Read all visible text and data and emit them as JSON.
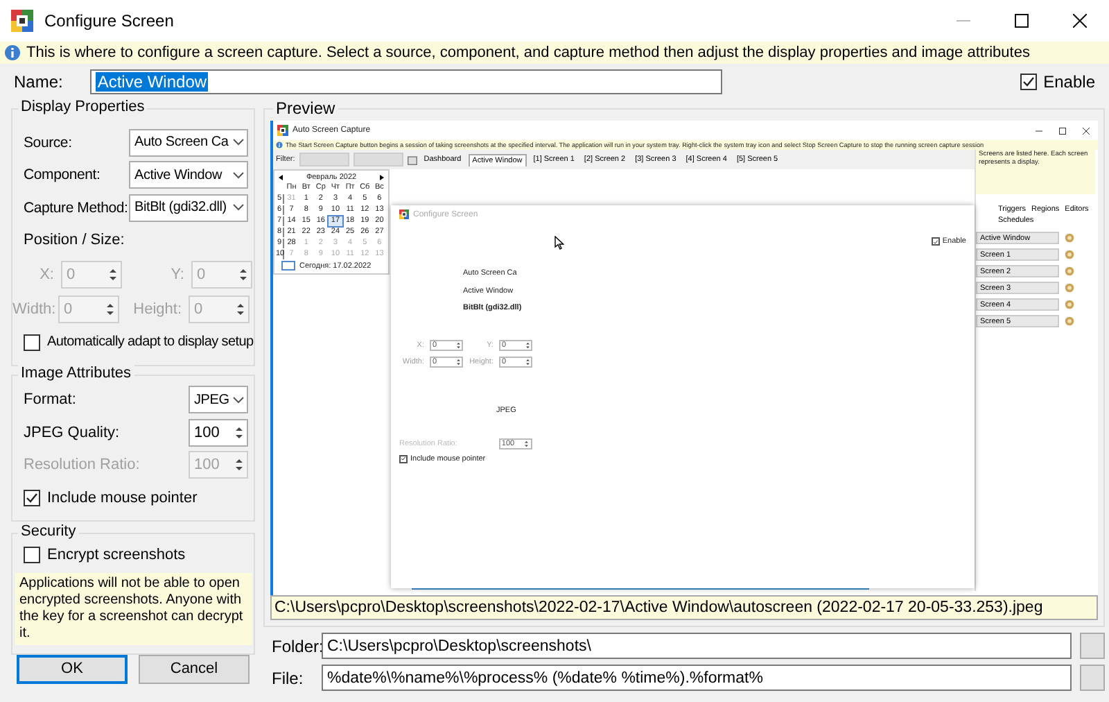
{
  "window": {
    "title": "Configure Screen"
  },
  "info": "This is where to configure a screen capture. Select a source, component, and capture method then adjust the display properties and image attributes",
  "name": {
    "label": "Name:",
    "value": "Active Window"
  },
  "enable": {
    "label": "Enable",
    "checked": true
  },
  "display_properties": {
    "title": "Display Properties",
    "dropdowns": [
      {
        "label": "Source:",
        "value": "Auto Screen Ca"
      },
      {
        "label": "Component:",
        "value": "Active Window"
      },
      {
        "label": "Capture Method:",
        "value": "BitBlt (gdi32.dll)"
      }
    ],
    "position_label": "Position / Size:",
    "spinners": [
      {
        "label": "X:",
        "value": "0",
        "disabled": true
      },
      {
        "label": "Y:",
        "value": "0",
        "disabled": true
      },
      {
        "label": "Width:",
        "value": "0",
        "disabled": true
      },
      {
        "label": "Height:",
        "value": "0",
        "disabled": true
      }
    ],
    "auto_adapt": {
      "label": "Automatically adapt to display setup",
      "checked": false
    }
  },
  "image_attributes": {
    "title": "Image Attributes",
    "format": {
      "label": "Format:",
      "value": "JPEG"
    },
    "spinners": [
      {
        "label": "JPEG Quality:",
        "value": "100",
        "disabled": false
      },
      {
        "label": "Resolution Ratio:",
        "value": "100",
        "disabled": true
      }
    ],
    "mouse_pointer": {
      "label": "Include mouse pointer",
      "checked": true
    }
  },
  "security": {
    "title": "Security",
    "encrypt": {
      "label": "Encrypt screenshots",
      "checked": false
    },
    "note": "Applications will not be able to open encrypted screenshots. Anyone with the key for a screenshot can decrypt it."
  },
  "buttons": [
    {
      "label": "OK",
      "default": true
    },
    {
      "label": "Cancel",
      "default": false
    }
  ],
  "preview": {
    "title": "Preview",
    "capture": {
      "title": "Auto Screen Capture",
      "info": "The Start Screen Capture button begins a session of taking screenshots at the specified interval. The application will run in your system tray. Right-click the system tray icon and select Stop Screen Capture to stop the running screen capture session",
      "filter_label": "Filter:",
      "tabs": [
        {
          "label": "Dashboard",
          "selected": false
        },
        {
          "label": "Active Window",
          "selected": true
        },
        {
          "label": "[1] Screen 1",
          "selected": false
        },
        {
          "label": "[2] Screen 2",
          "selected": false
        },
        {
          "label": "[3] Screen 3",
          "selected": false
        },
        {
          "label": "[4] Screen 4",
          "selected": false
        },
        {
          "label": "[5] Screen 5",
          "selected": false
        }
      ],
      "calendar": {
        "month": "Февраль 2022",
        "weekdays": [
          "Пн",
          "Вт",
          "Ср",
          "Чт",
          "Пт",
          "Сб",
          "Вс"
        ],
        "weeks": [
          {
            "week": "5",
            "days": [
              {
                "day": "31",
                "muted": true,
                "selected": false
              },
              {
                "day": "1",
                "muted": false,
                "selected": false
              },
              {
                "day": "2",
                "muted": false,
                "selected": false
              },
              {
                "day": "3",
                "muted": false,
                "selected": false
              },
              {
                "day": "4",
                "muted": false,
                "selected": false
              },
              {
                "day": "5",
                "muted": false,
                "selected": false
              },
              {
                "day": "6",
                "muted": false,
                "selected": false
              }
            ]
          },
          {
            "week": "6",
            "days": [
              {
                "day": "7",
                "muted": false,
                "selected": false
              },
              {
                "day": "8",
                "muted": false,
                "selected": false
              },
              {
                "day": "9",
                "muted": false,
                "selected": false
              },
              {
                "day": "10",
                "muted": false,
                "selected": false
              },
              {
                "day": "11",
                "muted": false,
                "selected": false
              },
              {
                "day": "12",
                "muted": false,
                "selected": false
              },
              {
                "day": "13",
                "muted": false,
                "selected": false
              }
            ]
          },
          {
            "week": "7",
            "days": [
              {
                "day": "14",
                "muted": false,
                "selected": false
              },
              {
                "day": "15",
                "muted": false,
                "selected": false
              },
              {
                "day": "16",
                "muted": false,
                "selected": false
              },
              {
                "day": "17",
                "muted": false,
                "selected": true
              },
              {
                "day": "18",
                "muted": false,
                "selected": false
              },
              {
                "day": "19",
                "muted": false,
                "selected": false
              },
              {
                "day": "20",
                "muted": false,
                "selected": false
              }
            ]
          },
          {
            "week": "8",
            "days": [
              {
                "day": "21",
                "muted": false,
                "selected": false
              },
              {
                "day": "22",
                "muted": false,
                "selected": false
              },
              {
                "day": "23",
                "muted": false,
                "selected": false
              },
              {
                "day": "24",
                "muted": false,
                "selected": false
              },
              {
                "day": "25",
                "muted": false,
                "selected": false
              },
              {
                "day": "26",
                "muted": false,
                "selected": false
              },
              {
                "day": "27",
                "muted": false,
                "selected": false
              }
            ]
          },
          {
            "week": "9",
            "days": [
              {
                "day": "28",
                "muted": false,
                "selected": false
              },
              {
                "day": "1",
                "muted": true,
                "selected": false
              },
              {
                "day": "2",
                "muted": true,
                "selected": false
              },
              {
                "day": "3",
                "muted": true,
                "selected": false
              },
              {
                "day": "4",
                "muted": true,
                "selected": false
              },
              {
                "day": "5",
                "muted": true,
                "selected": false
              },
              {
                "day": "6",
                "muted": true,
                "selected": false
              }
            ]
          },
          {
            "week": "10",
            "days": [
              {
                "day": "7",
                "muted": true,
                "selected": false
              },
              {
                "day": "8",
                "muted": true,
                "selected": false
              },
              {
                "day": "9",
                "muted": true,
                "selected": false
              },
              {
                "day": "10",
                "muted": true,
                "selected": false
              },
              {
                "day": "11",
                "muted": true,
                "selected": false
              },
              {
                "day": "12",
                "muted": true,
                "selected": false
              },
              {
                "day": "13",
                "muted": true,
                "selected": false
              }
            ]
          }
        ],
        "today": "Сегодня: 17.02.2022"
      },
      "help_text": "Screens are listed here. Each screen represents a display.",
      "side_tabs": [
        "Triggers",
        "Regions",
        "Editors",
        "Schedules"
      ],
      "screens": [
        "Active Window",
        "Screen 1",
        "Screen 2",
        "Screen 3",
        "Screen 4",
        "Screen 5"
      ],
      "dialog": {
        "title": "Configure Screen",
        "enable": {
          "label": "Enable",
          "checked": true
        },
        "values": [
          "Auto Screen Ca",
          "Active Window",
          "BitBlt (gdi32.dll)"
        ],
        "spinners": [
          {
            "label": "X:",
            "value": "0"
          },
          {
            "label": "Y:",
            "value": "0"
          },
          {
            "label": "Width:",
            "value": "0"
          },
          {
            "label": "Height:",
            "value": "0"
          }
        ],
        "format": "JPEG",
        "ratio": {
          "label": "Resolution Ratio:",
          "value": "100"
        },
        "mouse_pointer": {
          "label": "Include mouse pointer",
          "checked": true
        }
      }
    },
    "path": "C:\\Users\\pcpro\\Desktop\\screenshots\\2022-02-17\\Active Window\\autoscreen (2022-02-17 20-05-33.253).jpeg"
  },
  "folder": {
    "label": "Folder:",
    "value": "C:\\Users\\pcpro\\Desktop\\screenshots\\"
  },
  "file": {
    "label": "File:",
    "value": "%date%\\%name%\\%process% (%date% %time%).%format%"
  }
}
